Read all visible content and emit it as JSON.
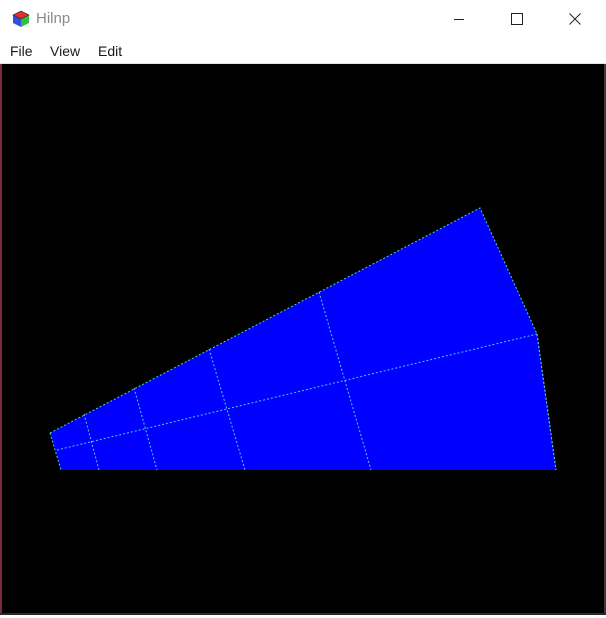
{
  "window": {
    "title": "Hilnp"
  },
  "menu": {
    "items": [
      "File",
      "View",
      "Edit"
    ]
  },
  "titlebar_controls": {
    "minimize_icon": "minimize-icon",
    "maximize_icon": "maximize-icon",
    "close_icon": "close-icon"
  },
  "scene": {
    "background_color": "#000000",
    "fill_color": "#0000ff",
    "grid_line_color": "#4fd0d0",
    "grid_line_style": "dashed"
  }
}
